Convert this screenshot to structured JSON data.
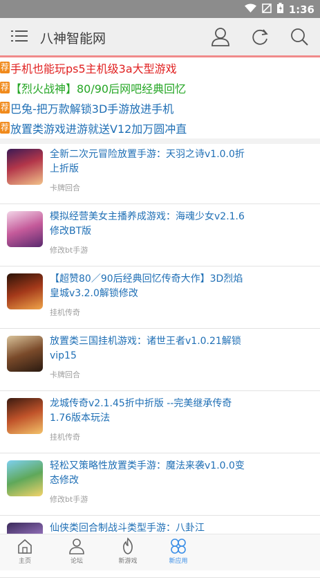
{
  "status_bar": {
    "time": "1:36"
  },
  "header": {
    "title": "八神智能网"
  },
  "recommended": {
    "badge": "荐",
    "items": [
      {
        "text": "手机也能玩ps5主机级3a大型游戏",
        "color": "#e02020"
      },
      {
        "text": "【烈火战神】80/90后网吧经典回忆",
        "color": "#25a625"
      },
      {
        "text": "巴兔-把万款解锁3D手游放进手机",
        "color": "#1f6fb5"
      },
      {
        "text": "放置类游戏进游就送V12加万圆冲直",
        "color": "#1f6fb5"
      }
    ]
  },
  "games": [
    {
      "title": "全新二次元冒险放置手游：天羽之诗v1.0.0折上折版",
      "category": "卡牌回合",
      "icon": "game-cover-icon"
    },
    {
      "title": "模拟经营美女主播养成游戏：海魂少女v2.1.6修改BT版",
      "category": "修改bt手游",
      "icon": "game-cover-icon"
    },
    {
      "title": "【超赞80／90后经典回忆传奇大作】3D烈焰皇城v3.2.0解锁修改",
      "category": "挂机传奇",
      "icon": "game-cover-icon"
    },
    {
      "title": "放置类三国挂机游戏：诸世王者v1.0.21解锁vip15",
      "category": "卡牌回合",
      "icon": "game-cover-icon"
    },
    {
      "title": "龙城传奇v2.1.45折中折版 --完美继承传奇1.76版本玩法",
      "category": "挂机传奇",
      "icon": "game-cover-icon"
    },
    {
      "title": "轻松又策略性放置类手游：魔法来袭v1.0.0变态修改",
      "category": "修改bt手游",
      "icon": "game-cover-icon"
    },
    {
      "title": "仙侠类回合制战斗类型手游：八卦江",
      "category": "",
      "icon": "game-cover-icon"
    }
  ],
  "bottom_nav": [
    {
      "label": "主页",
      "icon": "home-icon"
    },
    {
      "label": "论坛",
      "icon": "forum-icon"
    },
    {
      "label": "新游戏",
      "icon": "new-game-icon"
    },
    {
      "label": "新应用",
      "icon": "new-app-icon",
      "active": true
    }
  ],
  "colors": {
    "accent": "#3a8ee6",
    "header_border": "#f08a8a",
    "link": "#1f6fb5",
    "badge": "#f08a1c"
  }
}
